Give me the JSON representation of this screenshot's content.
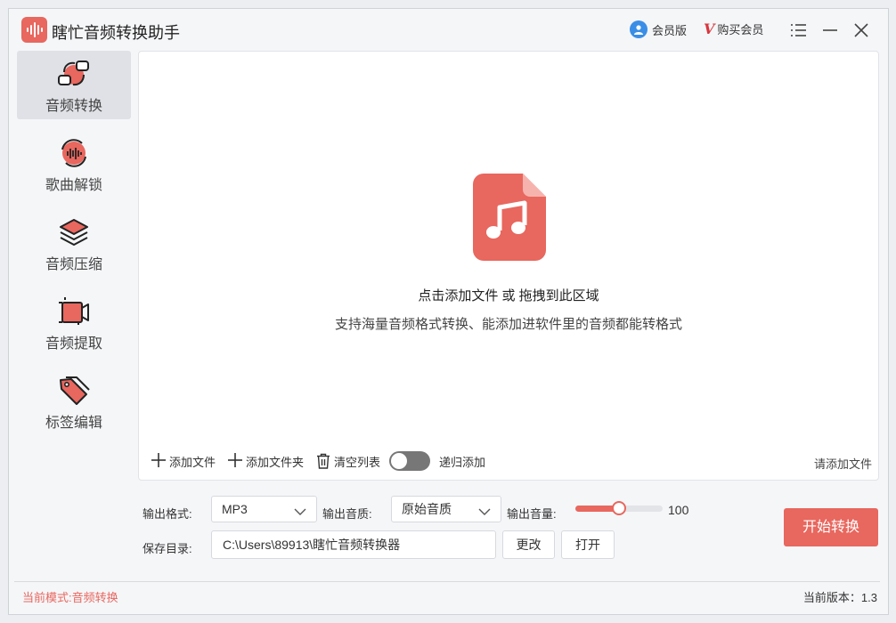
{
  "app": {
    "title": "瞎忙音频转换助手"
  },
  "header": {
    "member_version": "会员版",
    "buy_member": "购买会员",
    "vip_mark": "V"
  },
  "sidebar": {
    "items": [
      {
        "label": "音频转换",
        "icon": "convert-icon",
        "active": true
      },
      {
        "label": "歌曲解锁",
        "icon": "unlock-song-icon",
        "active": false
      },
      {
        "label": "音频压缩",
        "icon": "compress-layers-icon",
        "active": false
      },
      {
        "label": "音频提取",
        "icon": "extract-video-icon",
        "active": false
      },
      {
        "label": "标签编辑",
        "icon": "tag-icon",
        "active": false
      }
    ]
  },
  "droparea": {
    "title": "点击添加文件 或 拖拽到此区域",
    "subtitle": "支持海量音频格式转换、能添加进软件里的音频都能转格式",
    "hint": "请添加文件"
  },
  "toolbar": {
    "add_file": "添加文件",
    "add_folder": "添加文件夹",
    "clear_list": "清空列表",
    "recursive_add": "递归添加",
    "recursive_on": false
  },
  "settings": {
    "format_label": "输出格式:",
    "format_value": "MP3",
    "quality_label": "输出音质:",
    "quality_value": "原始音质",
    "volume_label": "输出音量:",
    "volume_value": "100",
    "volume_level": 0.5,
    "save_label": "保存目录:",
    "save_path": "C:\\Users\\89913\\瞎忙音频转换器",
    "change_btn": "更改",
    "open_btn": "打开",
    "start_btn": "开始转换"
  },
  "status": {
    "mode": "当前模式:音频转换",
    "version": "当前版本：1.3"
  },
  "colors": {
    "accent": "#e8675e",
    "member_blue": "#3a8ee6",
    "vip_red": "#d9363e"
  }
}
